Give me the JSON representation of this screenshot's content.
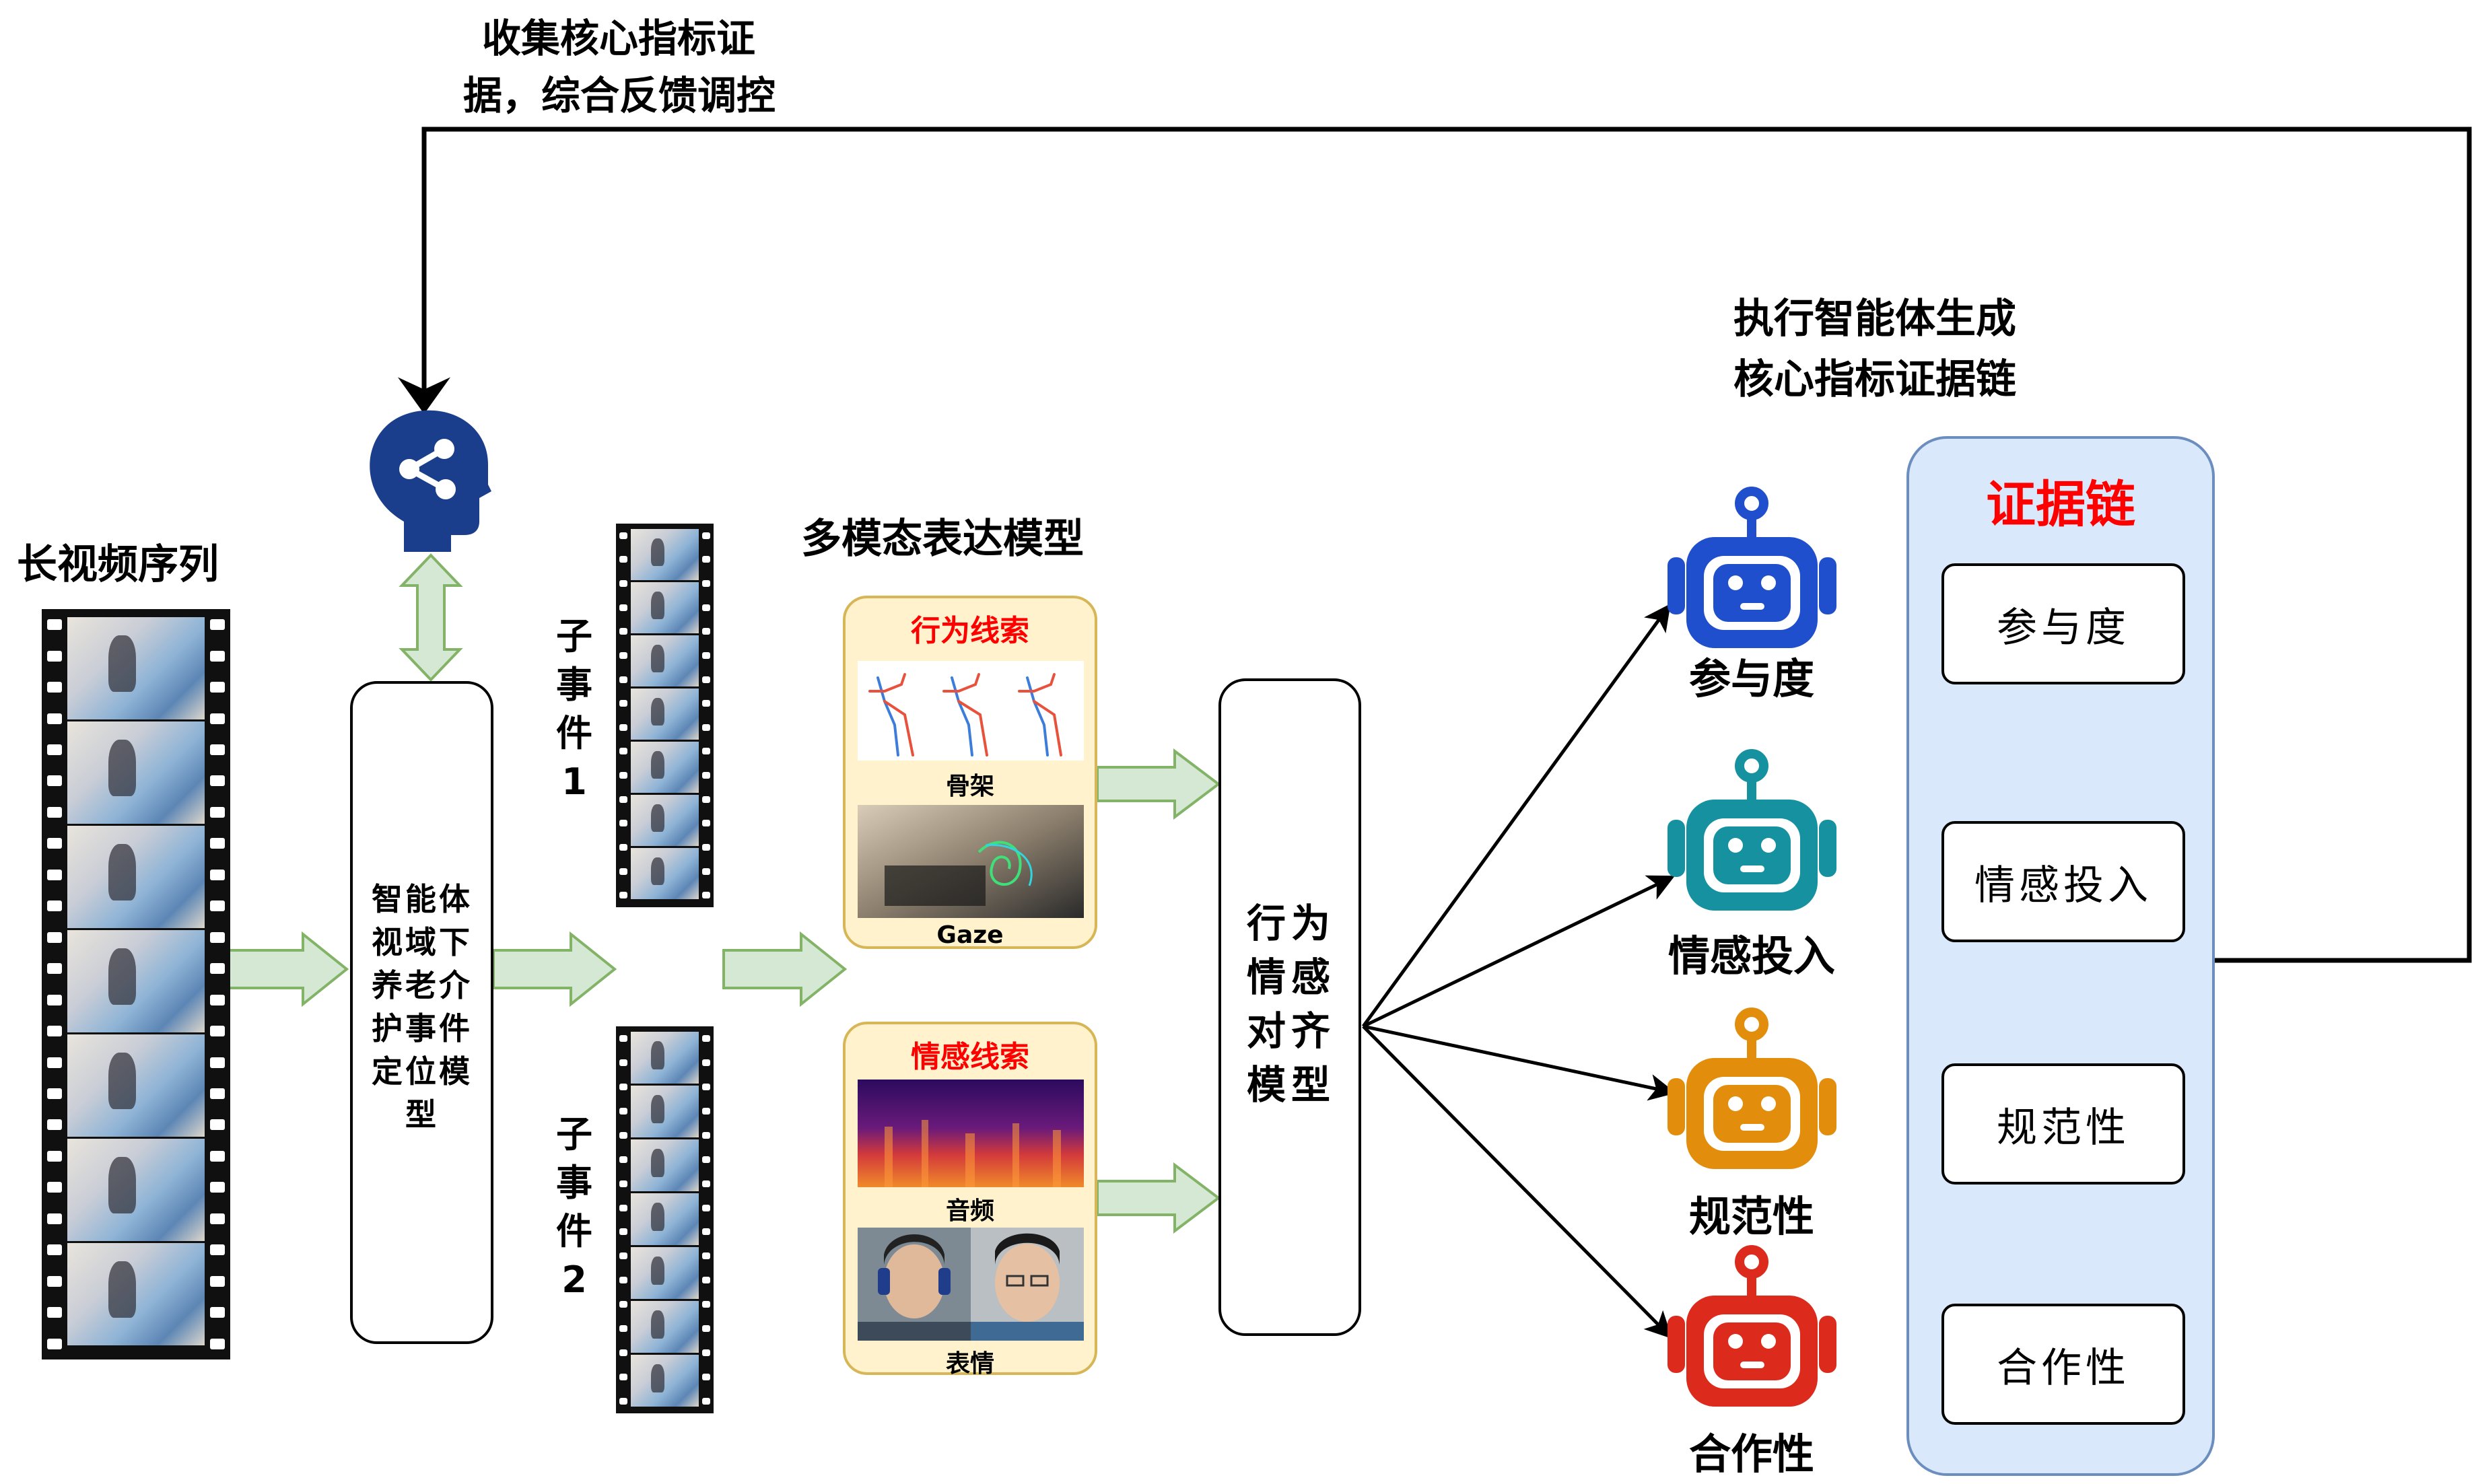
{
  "feedback": {
    "line1": "收集核心指标证",
    "line2": "据，综合反馈调控"
  },
  "long_video": {
    "label": "长视频序列"
  },
  "localizer": {
    "text": "智能体视域下养老介护事件定位模型"
  },
  "sub_events": [
    {
      "label": "子事件1"
    },
    {
      "label": "子事件2"
    }
  ],
  "multimodal": {
    "title": "多模态表达模型"
  },
  "behavior_cue": {
    "title": "行为线索",
    "skeleton_caption": "骨架",
    "gaze_caption": "Gaze"
  },
  "emotion_cue": {
    "title": "情感线索",
    "audio_caption": "音频",
    "face_caption": "表情"
  },
  "alignment": {
    "text": "行为情感对齐模型"
  },
  "agents_header": {
    "line1": "执行智能体生成",
    "line2": "核心指标证据链"
  },
  "agents": [
    {
      "label": "参与度",
      "color": "#1f4fcc",
      "icon": "robot-icon"
    },
    {
      "label": "情感投入",
      "color": "#1591a0",
      "icon": "robot-icon"
    },
    {
      "label": "规范性",
      "color": "#e38d0c",
      "icon": "robot-icon"
    },
    {
      "label": "合作性",
      "color": "#dc2a1d",
      "icon": "robot-icon"
    }
  ],
  "evidence_chain": {
    "title": "证据链",
    "title_color": "#ff0000",
    "items": [
      "参与度",
      "情感投入",
      "规范性",
      "合作性"
    ]
  },
  "colors": {
    "arrow_green_fill": "#d5e8d4",
    "arrow_green_stroke": "#82b366",
    "head_icon": "#1a3e8c",
    "panel_fill": "#dae8fc"
  }
}
